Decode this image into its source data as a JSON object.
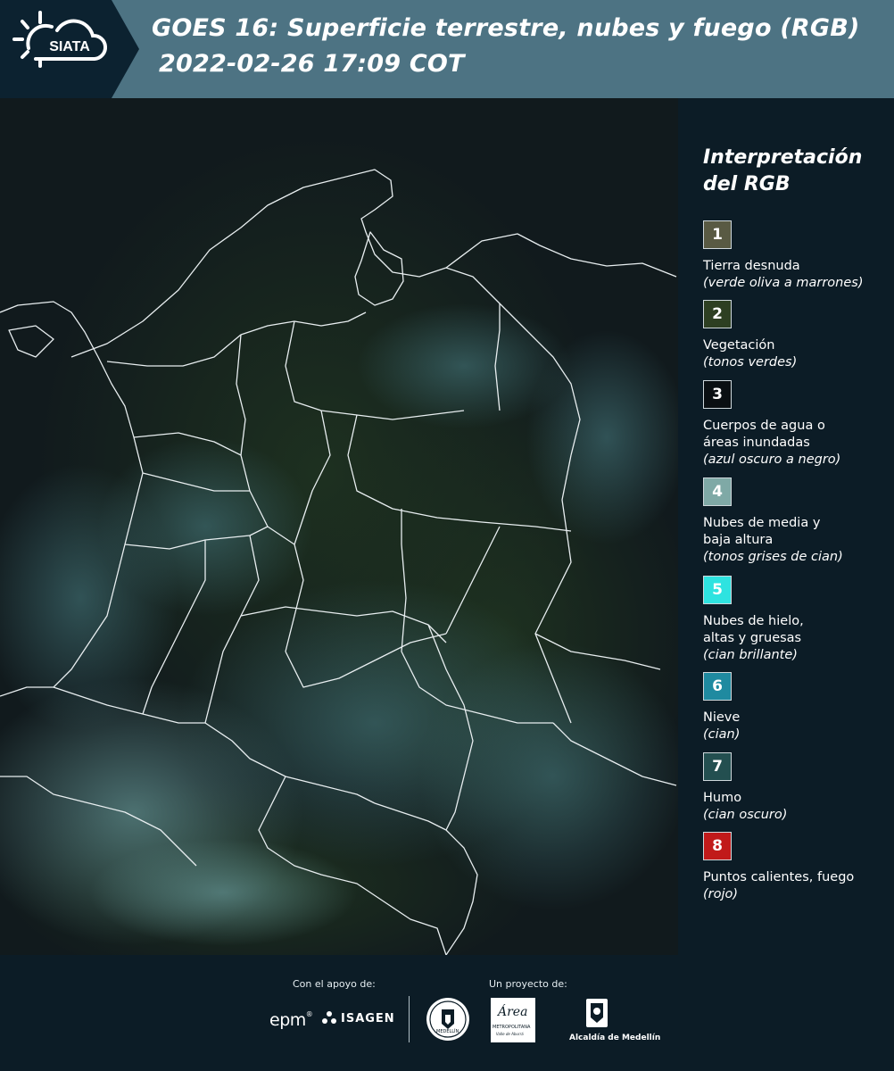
{
  "header": {
    "logo_text": "SIATA",
    "title_line1": "GOES 16: Superficie terrestre, nubes y fuego (RGB)",
    "title_line2": "2022-02-26 17:09 COT"
  },
  "legend": {
    "title": "Interpretación del RGB",
    "items": [
      {
        "num": "1",
        "name": "Tierra desnuda",
        "desc": "(verde oliva a marrones)",
        "color": "#595a43"
      },
      {
        "num": "2",
        "name": "Vegetación",
        "desc": "(tonos verdes)",
        "color": "#2d3f22"
      },
      {
        "num": "3",
        "name": "Cuerpos de agua o áreas inundadas",
        "desc": "(azul oscuro a negro)",
        "color": "#0a0f12"
      },
      {
        "num": "4",
        "name": "Nubes de media y baja altura",
        "desc": "(tonos grises de cian)",
        "color": "#7fa9a6"
      },
      {
        "num": "5",
        "name": "Nubes de hielo, altas y gruesas",
        "desc": "(cian brillante)",
        "color": "#2ee3e0"
      },
      {
        "num": "6",
        "name": "Nieve",
        "desc": "(cian)",
        "color": "#1f8aa0"
      },
      {
        "num": "7",
        "name": "Humo",
        "desc": "(cian oscuro)",
        "color": "#234f50"
      },
      {
        "num": "8",
        "name": "Puntos calientes, fuego",
        "desc": "(rojo)",
        "color": "#c11a1a"
      }
    ]
  },
  "footer": {
    "support_label": "Con el apoyo de:",
    "project_label": "Un proyecto de:",
    "logos": {
      "epm": "epm",
      "isagen": "ISAGEN",
      "area_metro": "Área",
      "area_metro_sub": "METROPOLITANA",
      "area_metro_sub2": "Valle de Aburrá",
      "alcaldia": "Alcaldía de Medellín",
      "univ": "MEDELLÍN"
    }
  },
  "colors": {
    "header_bg": "#4d7383",
    "panel_bg": "#0c1c26",
    "map_bg": "#111a1d"
  }
}
